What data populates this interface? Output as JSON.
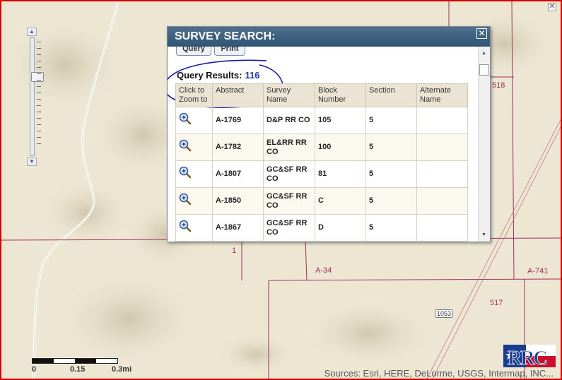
{
  "map": {
    "labels": {
      "tr": "518",
      "mid": "1",
      "a34": "A-34",
      "a741": "A-741",
      "n517": "517",
      "road": "1053"
    },
    "scalebar": {
      "l0": "0",
      "l1": "0.15",
      "l2": "0.3mi"
    },
    "attribution": "Sources: Esri, HERE, DeLorme, USGS, Intermap, INC...",
    "logo_text": "RRC"
  },
  "dialog": {
    "title": "SURVEY SEARCH:",
    "close": "✕",
    "query_btn": "Query",
    "print_btn": "Print",
    "results_label": "Query Results:",
    "results_count": "116",
    "columns": [
      "Click to Zoom to",
      "Abstract",
      "Survey Name",
      "Block Number",
      "Section",
      "Alternate Name"
    ],
    "rows": [
      {
        "abstract": "A-1769",
        "survey": "D&P RR CO",
        "block": "105",
        "section": "5",
        "alt": ""
      },
      {
        "abstract": "A-1782",
        "survey": "EL&RR RR CO",
        "block": "100",
        "section": "5",
        "alt": ""
      },
      {
        "abstract": "A-1807",
        "survey": "GC&SF RR CO",
        "block": "81",
        "section": "5",
        "alt": ""
      },
      {
        "abstract": "A-1850",
        "survey": "GC&SF RR CO",
        "block": "C",
        "section": "5",
        "alt": ""
      },
      {
        "abstract": "A-1867",
        "survey": "GC&SF RR CO",
        "block": "D",
        "section": "5",
        "alt": ""
      }
    ]
  },
  "colors": {
    "title_bar": "#2f5575",
    "annotation": "#1a1aa8",
    "frame": "#d40000",
    "parcel_line": "#a0305a"
  }
}
